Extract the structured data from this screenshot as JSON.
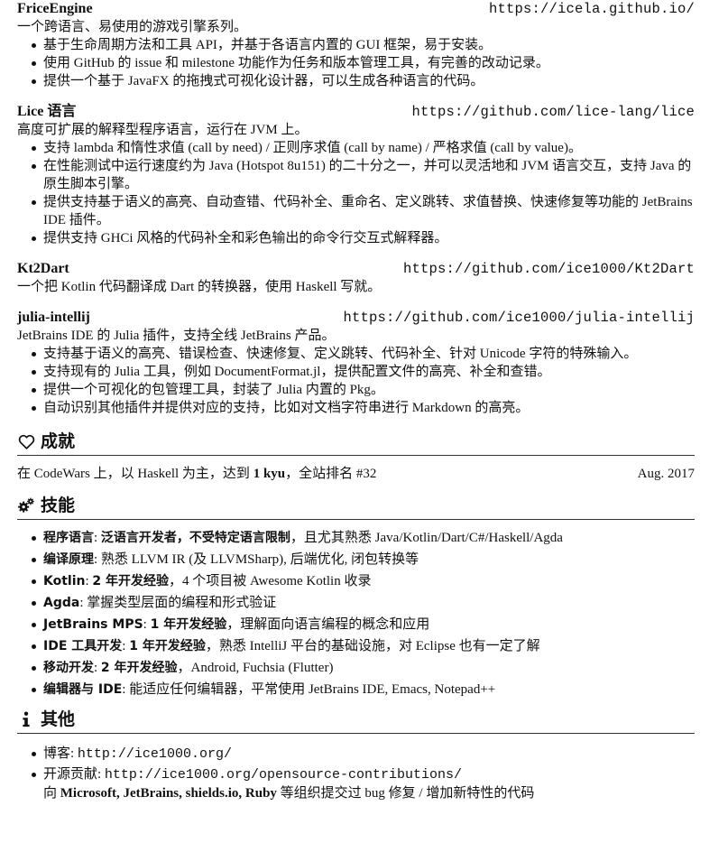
{
  "projects": [
    {
      "title": "FriceEngine",
      "url": "https://icela.github.io/",
      "desc": "一个跨语言、易使用的游戏引擎系列。",
      "bullets": [
        "基于生命周期方法和工具 API，并基于各语言内置的 GUI 框架，易于安装。",
        "使用 GitHub 的 issue 和 milestone 功能作为任务和版本管理工具，有完善的改动记录。",
        "提供一个基于 JavaFX 的拖拽式可视化设计器，可以生成各种语言的代码。"
      ]
    },
    {
      "title": "Lice 语言",
      "url": "https://github.com/lice-lang/lice",
      "desc": "高度可扩展的解释型程序语言，运行在 JVM 上。",
      "bullets": [
        "支持 lambda 和惰性求值 (call by need) / 正则序求值 (call by name) / 严格求值 (call by value)。",
        "在性能测试中运行速度约为 Java (Hotspot 8u151) 的二十分之一，并可以灵活地和 JVM 语言交互，支持 Java 的原生脚本引擎。",
        "提供支持基于语义的高亮、自动查错、代码补全、重命名、定义跳转、求值替换、快速修复等功能的 JetBrains IDE 插件。",
        "提供支持 GHCi 风格的代码补全和彩色输出的命令行交互式解释器。"
      ]
    },
    {
      "title": "Kt2Dart",
      "url": "https://github.com/ice1000/Kt2Dart",
      "desc": "一个把 Kotlin 代码翻译成 Dart 的转换器，使用 Haskell 写就。",
      "bullets": []
    },
    {
      "title": "julia-intellij",
      "url": "https://github.com/ice1000/julia-intellij",
      "desc": "JetBrains IDE 的 Julia 插件，支持全线 JetBrains 产品。",
      "bullets": [
        "支持基于语义的高亮、错误检查、快速修复、定义跳转、代码补全、针对 Unicode 字符的特殊输入。",
        "支持现有的 Julia 工具，例如 DocumentFormat.jl，提供配置文件的高亮、补全和查错。",
        "提供一个可视化的包管理工具，封装了 Julia 内置的 Pkg。",
        "自动识别其他插件并提供对应的支持，比如对文档字符串进行 Markdown 的高亮。"
      ]
    }
  ],
  "achievements": {
    "heading": "成就",
    "icon": "heart-outline-icon",
    "prefix": "在 CodeWars 上，以 Haskell 为主，达到 ",
    "rank": "1 kyu",
    "suffix": "，全站排名 #32",
    "date": "Aug. 2017"
  },
  "skills": {
    "heading": "技能",
    "icon": "cogs-icon",
    "items": [
      {
        "label": "程序语言",
        "sep": ": ",
        "bold_text": "泛语言开发者，不受特定语言限制",
        "text": "，且尤其熟悉 Java/Kotlin/Dart/C#/Haskell/Agda"
      },
      {
        "label": "编译原理",
        "sep": ": ",
        "bold_text": "",
        "text": "熟悉 LLVM IR (及 LLVMSharp), 后端优化, 闭包转换等"
      },
      {
        "label": "Kotlin",
        "sep": ": ",
        "bold_text": "2 年开发经验",
        "text": "，4 个项目被 Awesome Kotlin 收录"
      },
      {
        "label": "Agda",
        "sep": ": ",
        "bold_text": "",
        "text": "掌握类型层面的编程和形式验证"
      },
      {
        "label": "JetBrains MPS",
        "sep": ": ",
        "bold_text": "1 年开发经验",
        "text": "，理解面向语言编程的概念和应用"
      },
      {
        "label": "IDE 工具开发",
        "sep": ": ",
        "bold_text": "1 年开发经验",
        "text": "，熟悉 IntelliJ 平台的基础设施，对 Eclipse 也有一定了解"
      },
      {
        "label": "移动开发",
        "sep": ": ",
        "bold_text": "2 年开发经验",
        "text": "，Android, Fuchsia (Flutter)"
      },
      {
        "label": "编辑器与 IDE",
        "sep": ": ",
        "bold_text": "",
        "text": "能适应任何编辑器，平常使用 JetBrains IDE, Emacs, Notepad++"
      }
    ]
  },
  "others": {
    "heading": "其他",
    "icon": "info-icon",
    "blog_label": "博客: ",
    "blog_url": "http://ice1000.org/",
    "oss_label": "开源贡献: ",
    "oss_url": "http://ice1000.org/opensource-contributions/",
    "oss_prefix": "向 ",
    "oss_orgs": "Microsoft, JetBrains, shields.io, Ruby",
    "oss_suffix": " 等组织提交过 bug 修复 / 增加新特性的代码"
  }
}
